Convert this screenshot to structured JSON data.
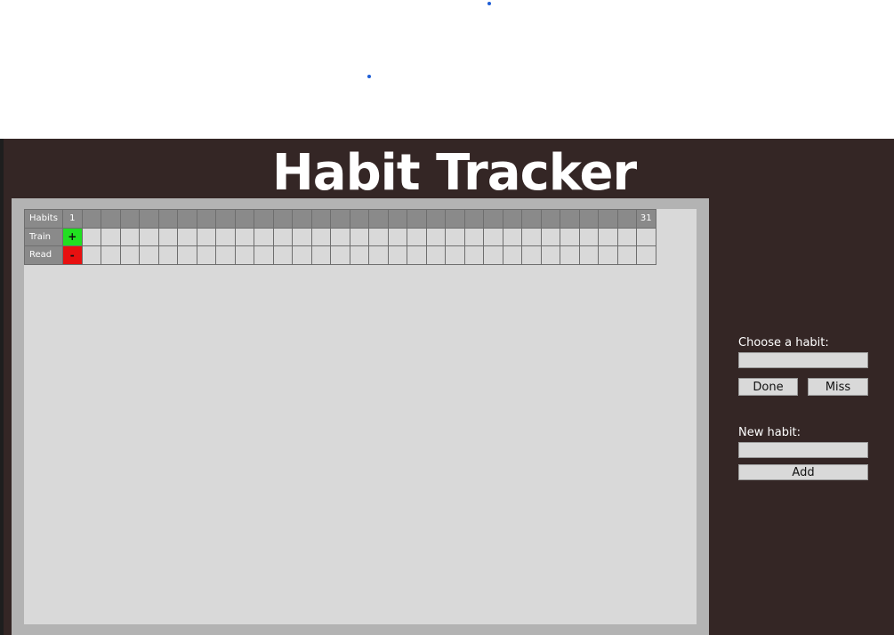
{
  "app": {
    "title": "Habit Tracker"
  },
  "tracker": {
    "header_label": "Habits",
    "days": 31,
    "first_day_label": "1",
    "last_day_label": "31",
    "habits": [
      {
        "name": "Train",
        "entries": {
          "1": "+"
        },
        "status": "done"
      },
      {
        "name": "Read",
        "entries": {
          "1": "-"
        },
        "status": "miss"
      }
    ]
  },
  "controls": {
    "choose_label": "Choose a habit:",
    "choose_value": "",
    "done_label": "Done",
    "miss_label": "Miss",
    "new_label": "New habit:",
    "new_value": "",
    "add_label": "Add"
  },
  "colors": {
    "background": "#342625",
    "done": "#21e021",
    "miss": "#e81010"
  }
}
